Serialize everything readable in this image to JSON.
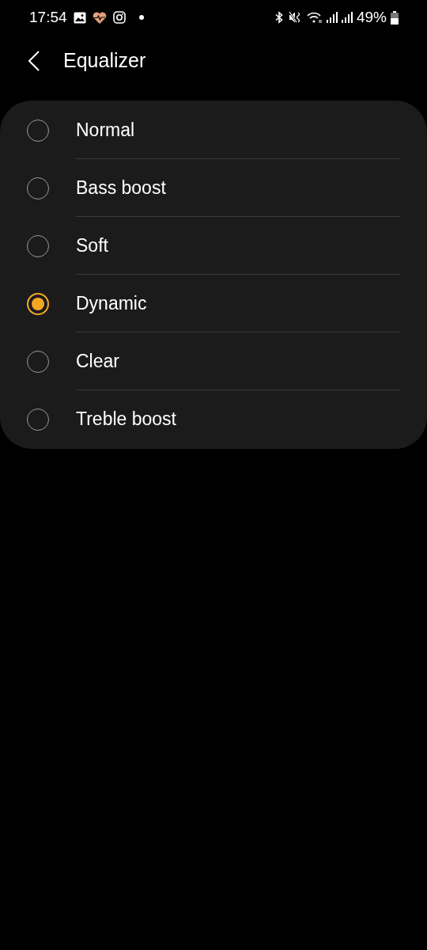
{
  "status_bar": {
    "time": "17:54",
    "battery": "49%"
  },
  "header": {
    "title": "Equalizer"
  },
  "options": [
    {
      "label": "Normal",
      "selected": false
    },
    {
      "label": "Bass boost",
      "selected": false
    },
    {
      "label": "Soft",
      "selected": false
    },
    {
      "label": "Dynamic",
      "selected": true
    },
    {
      "label": "Clear",
      "selected": false
    },
    {
      "label": "Treble boost",
      "selected": false
    }
  ]
}
